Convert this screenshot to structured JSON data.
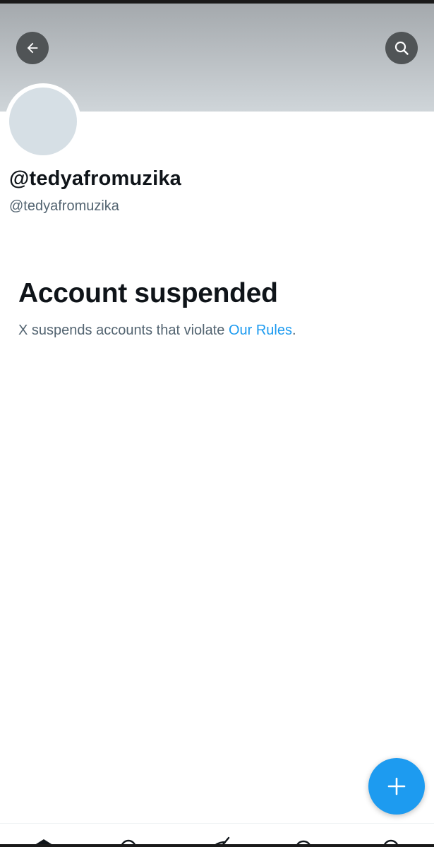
{
  "profile": {
    "display_name": "@tedyafromuzika",
    "handle": "@tedyafromuzika"
  },
  "suspension": {
    "title": "Account suspended",
    "message_prefix": "X suspends accounts that violate ",
    "rules_link": "Our Rules",
    "message_suffix": "."
  },
  "header": {
    "back_icon": "arrow-left-icon",
    "search_icon": "search-icon"
  },
  "fab": {
    "icon": "plus-icon"
  },
  "bottom_nav": {
    "items": [
      "home-icon",
      "search-icon",
      "grok-icon",
      "notifications-icon",
      "messages-icon"
    ]
  },
  "colors": {
    "accent": "#1d9bf0",
    "primary_text": "#0f1419",
    "secondary_text": "#536471",
    "banner": "#b8bdc1",
    "avatar_placeholder": "#d6dfe5"
  }
}
